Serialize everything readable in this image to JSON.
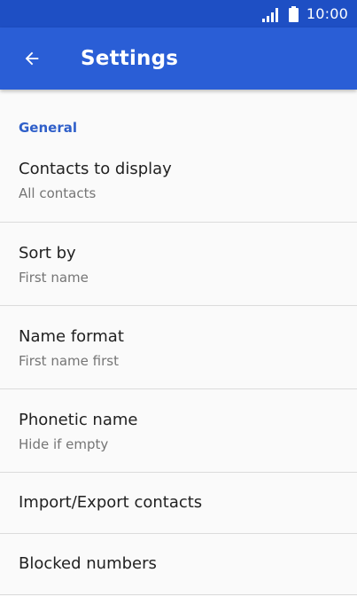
{
  "status_bar": {
    "time": "10:00",
    "icons": [
      "signal-icon",
      "battery-icon"
    ]
  },
  "app_bar": {
    "back_icon": "arrow-back-icon",
    "title": "Settings"
  },
  "colors": {
    "status_bar": "#1e4fc4",
    "app_bar": "#2a5ed6",
    "section_header": "#2f5fc9",
    "background": "#fafafa"
  },
  "section": {
    "header": "General",
    "items": [
      {
        "title": "Contacts to display",
        "summary": "All contacts"
      },
      {
        "title": "Sort by",
        "summary": "First name"
      },
      {
        "title": "Name format",
        "summary": "First name first"
      },
      {
        "title": "Phonetic name",
        "summary": "Hide if empty"
      },
      {
        "title": "Import/Export contacts"
      },
      {
        "title": "Blocked numbers"
      }
    ]
  }
}
